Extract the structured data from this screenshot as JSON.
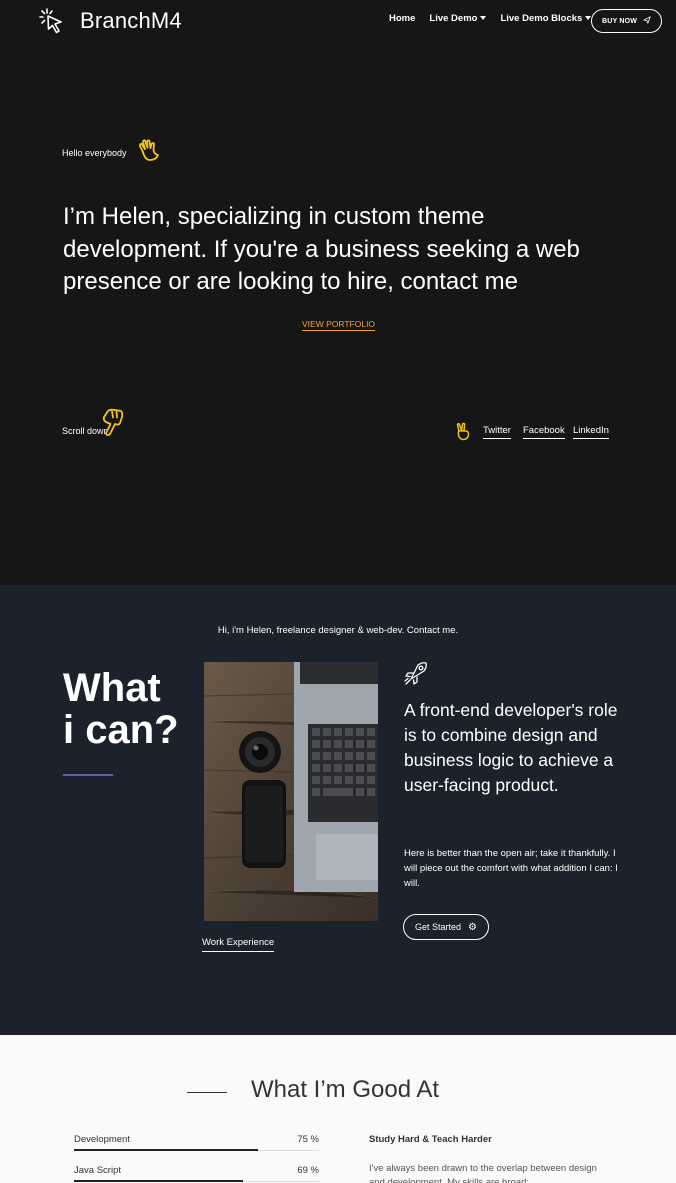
{
  "header": {
    "brand": "BranchM4",
    "nav": [
      {
        "label": "Home",
        "has_caret": false
      },
      {
        "label": "Live Demo",
        "has_caret": true
      },
      {
        "label": "Live Demo Blocks",
        "has_caret": true
      }
    ],
    "buy_label": "BUY NOW",
    "logo_icon": "cursor-click-icon",
    "buy_icon": "paper-plane-icon"
  },
  "hero": {
    "greeting": "Hello everybody",
    "greeting_icon": "waving-hand-icon",
    "headline": "I’m Helen, specializing in custom theme development. If you're a business seeking a web presence or are looking to hire, contact me",
    "portfolio_label": "VIEW PORTFOLIO",
    "scroll_label": "Scroll down",
    "scroll_icon": "pointing-hand-icon",
    "social_icon": "victory-hand-icon",
    "social": [
      "Twitter",
      "Facebook",
      "LinkedIn"
    ]
  },
  "about": {
    "intro": "Hi, i'm Helen, freelance designer & web-dev. Contact me.",
    "title_line1": "What",
    "title_line2": "i can?",
    "work_label": "Work Experience",
    "pitch": "A front-end developer's role is to combine design and business logic to achieve a user-facing product.",
    "body": "Here is better than the open air; take it thankfully. I will piece out the comfort with what addition I can: I will.",
    "cta_label": "Get Started",
    "cta_icon": "gear-icon",
    "feature_icon": "rocket-icon"
  },
  "skills": {
    "title": "What I’m Good At",
    "items": [
      {
        "label": "Development",
        "percent_text": "75 %",
        "value": 0.75
      },
      {
        "label": "Java Script",
        "percent_text": "69 %",
        "value": 0.69
      }
    ],
    "study_title": "Study Hard & Teach Harder",
    "study_text": "I've always been drawn to the overlap between design and development. My skills are broad:"
  },
  "colors": {
    "accent": "#f0a23a",
    "hero_bg": "#161616",
    "about_bg": "#1b222b",
    "title_underline": "#5866a8",
    "emoji_yellow": "#f5c518"
  }
}
